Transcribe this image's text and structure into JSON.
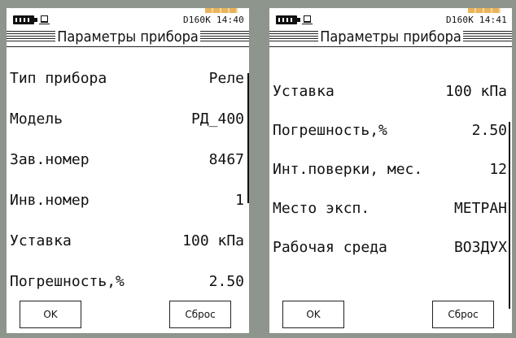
{
  "screens": [
    {
      "status": "D160K 14:40",
      "title": "Параметры прибора",
      "params": [
        {
          "label": "Тип прибора",
          "value": "Реле"
        },
        {
          "label": "Модель",
          "value": "РД_400"
        },
        {
          "label": "Зав.номер",
          "value": "8467"
        },
        {
          "label": "Инв.номер",
          "value": "1"
        },
        {
          "label": "Уставка",
          "value": "100 кПа"
        },
        {
          "label": "Погрешность,%",
          "value": "2.50"
        }
      ],
      "softkeys": {
        "ok": "OK",
        "reset": "Сброс"
      }
    },
    {
      "status": "D160K 14:41",
      "title": "Параметры прибора",
      "params": [
        {
          "label": "Уставка",
          "value": "100 кПа"
        },
        {
          "label": "Погрешность,%",
          "value": "2.50"
        },
        {
          "label": "Инт.поверки, мес.",
          "value": "12"
        },
        {
          "label": "Место эксп.",
          "value": "МЕТРАН"
        },
        {
          "label": "Рабочая среда",
          "value": "ВОЗДУХ"
        }
      ],
      "softkeys": {
        "ok": "OK",
        "reset": "Сброс"
      }
    }
  ],
  "icons": {
    "battery": "battery-icon",
    "storage": "storage-icon"
  },
  "colors": {
    "bezel": "#8e958c",
    "screen": "#ffffff",
    "accent": "#e9b35a"
  }
}
